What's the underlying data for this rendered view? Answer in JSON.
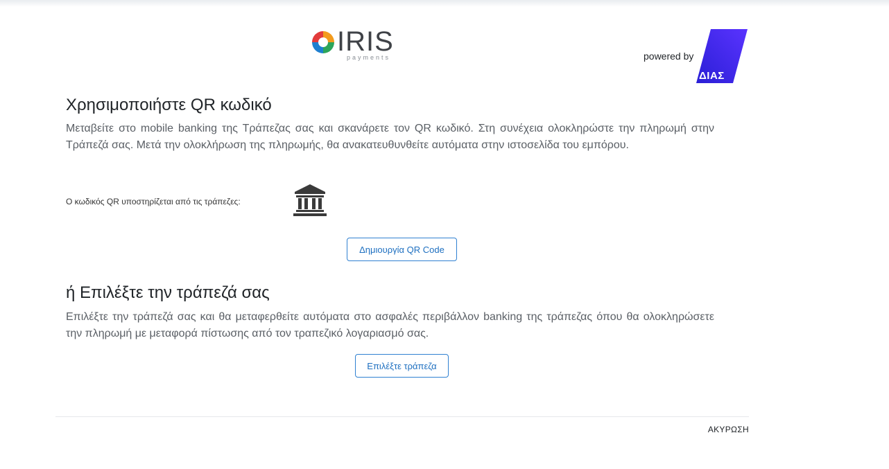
{
  "header": {
    "iris_logo_text": "IRIS",
    "iris_logo_subtext": "payments",
    "powered_by": "powered by",
    "dias_logo_text": "ΔΙΑΣ"
  },
  "qr_section": {
    "title": "Χρησιμοποιήστε QR κωδικό",
    "description": "Μεταβείτε στο mobile banking της Τράπεζας σας και σκανάρετε τον QR κωδικό. Στη συνέχεια ολοκληρώστε την πληρωμή στην Τράπεζά σας. Μετά την ολοκλήρωση της πληρωμής, θα ανακατευθυνθείτε αυτόματα στην ιστοσελίδα του εμπόρου.",
    "supported_banks_label": "Ο κωδικός QR υποστηρίζεται από τις τράπεζες:",
    "bank_icon": "bank-building-icon",
    "button_label": "Δημιουργία QR Code"
  },
  "bank_section": {
    "title": "ή Επιλέξτε την τράπεζά σας",
    "description": "Επιλέξτε την τράπεζά σας και θα μεταφερθείτε αυτόματα στο ασφαλές περιβάλλον banking της τράπεζας όπου θα ολοκληρώσετε την πληρωμή με μεταφορά πίστωσης από τον τραπεζικό λογαριασμό σας.",
    "button_label": "Επιλέξτε τράπεζα"
  },
  "footer": {
    "cancel_label": "ΑΚΥΡΩΣΗ"
  },
  "colors": {
    "button_border": "#2f80d1",
    "button_text": "#1d6fc0",
    "dias_gradient_start": "#2a1fd6",
    "dias_gradient_end": "#5a33ff"
  }
}
